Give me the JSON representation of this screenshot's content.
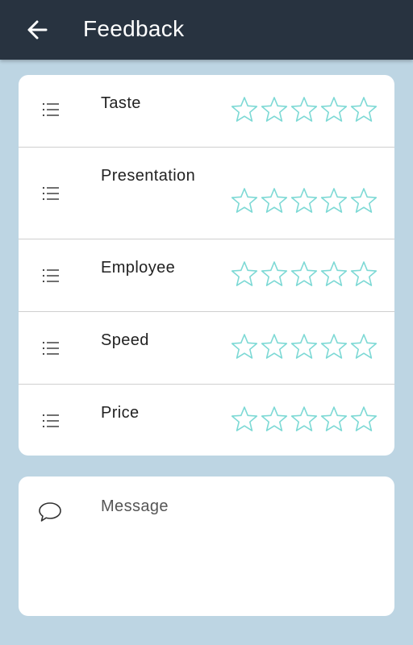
{
  "header": {
    "title": "Feedback",
    "back_icon": "arrow-left-icon"
  },
  "ratings": {
    "star_color": "#7dd9d5",
    "max_stars": 5,
    "items": [
      {
        "label": "Taste",
        "rating": 0,
        "icon": "list-icon"
      },
      {
        "label": "Presentation",
        "rating": 0,
        "icon": "list-icon"
      },
      {
        "label": "Employee",
        "rating": 0,
        "icon": "list-icon"
      },
      {
        "label": "Speed",
        "rating": 0,
        "icon": "list-icon"
      },
      {
        "label": "Price",
        "rating": 0,
        "icon": "list-icon"
      }
    ]
  },
  "message": {
    "placeholder": "Message",
    "value": "",
    "icon": "comment-icon"
  },
  "colors": {
    "appbar": "#283340",
    "background": "#bdd5e3",
    "card": "#ffffff"
  }
}
